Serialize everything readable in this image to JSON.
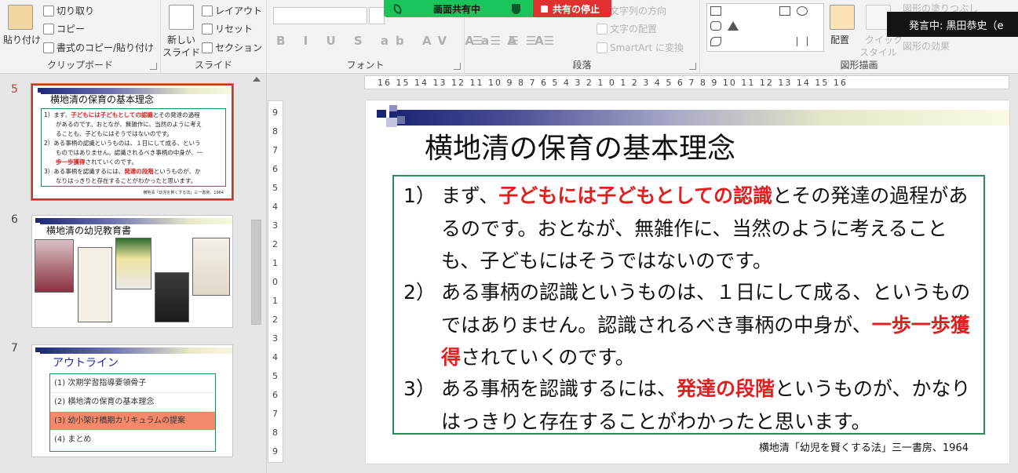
{
  "ribbon": {
    "clipboard": {
      "paste": "貼り付け",
      "cut": "切り取り",
      "copy": "コピー",
      "format_painter": "書式のコピー/貼り付け",
      "label": "クリップボード"
    },
    "slides": {
      "new_slide_line1": "新しい",
      "new_slide_line2": "スライド",
      "layout": "レイアウト",
      "reset": "リセット",
      "section": "セクション",
      "label": "スライド"
    },
    "font": {
      "format_buttons": "B I U S ab AV Aa A A",
      "label": "フォント"
    },
    "paragraph": {
      "text_direction": "文字列の方向",
      "align_text": "文字の配置",
      "smartart": "SmartArt に変換",
      "label": "段落"
    },
    "drawing": {
      "arrange": "配置",
      "quick_styles_line1": "クイック",
      "quick_styles_line2": "スタイル",
      "shape_fill": "図形の塗りつぶし",
      "shape_effects": "図形の効果",
      "label": "図形描画"
    }
  },
  "share_bar": {
    "status": "画面共有中",
    "stop": "共有の停止"
  },
  "speaker_tooltip": "発言中: 黒田恭史（e",
  "thumbnails": [
    {
      "number": "5",
      "title": "横地清の保育の基本理念",
      "lines": [
        {
          "pre": "1）まず、",
          "hl": "子どもには子どもとしての認識",
          "post": "とその発達の過程"
        },
        {
          "pre": "　　があるのです。おとなが、無雑作に、当然のように考え",
          "hl": "",
          "post": ""
        },
        {
          "pre": "　　ることも、子どもにはそうではないのです。",
          "hl": "",
          "post": ""
        },
        {
          "pre": "2）ある事柄の認識というものは、１日にして成る、という",
          "hl": "",
          "post": ""
        },
        {
          "pre": "　　ものではありません。認識されるべき事柄の中身が、一",
          "hl": "",
          "post": ""
        },
        {
          "pre": "　　",
          "hl": "歩一歩獲得",
          "post": "されていくのです。"
        },
        {
          "pre": "3）ある事柄を認識するには、",
          "hl": "発達の段階",
          "post": "というものが、か"
        },
        {
          "pre": "　　なりはっきりと存在することがわかったと思います。",
          "hl": "",
          "post": ""
        }
      ],
      "source": "横地清「幼児を賢くする法」三一書房、1964"
    },
    {
      "number": "6",
      "title": "横地清の幼児教育書"
    },
    {
      "number": "7",
      "title": "アウトライン",
      "items": [
        "(1) 次期学習指導要領骨子",
        "(2) 横地清の保育の基本理念",
        "(3) 幼小架け橋期カリキュラムの提案",
        "(4) まとめ"
      ]
    }
  ],
  "ruler": {
    "horizontal": "16 15 14 13 12 11 10 9 8 7 6 5 4 3 2 1 0 1 2 3 4 5 6 7 8 9 10 11 12 13 14 15 16",
    "vertical": [
      "9",
      "8",
      "7",
      "6",
      "5",
      "4",
      "3",
      "2",
      "1",
      "0",
      "1",
      "2",
      "3",
      "4",
      "5",
      "6",
      "7",
      "8",
      "9"
    ]
  },
  "slide": {
    "title": "横地清の保育の基本理念",
    "points": [
      {
        "num": "1）",
        "pre": "まず、",
        "hl": "子どもには子どもとしての認識",
        "post": "とその発達の過程があるのです。おとなが、無雑作に、当然のように考えることも、子どもにはそうではないのです。"
      },
      {
        "num": "2）",
        "pre": "ある事柄の認識というものは、１日にして成る、というものではありません。認識されるべき事柄の中身が、",
        "hl": "一歩一歩獲得",
        "post": "されていくのです。"
      },
      {
        "num": "3）",
        "pre": "ある事柄を認識するには、",
        "hl": "発達の段階",
        "post": "というものが、かなりはっきりと存在することがわかったと思います。"
      }
    ],
    "source": "横地清「幼児を賢くする法」三一書房、1964"
  },
  "colors": {
    "highlight_red": "#e02020",
    "box_green": "#2e8b57",
    "share_green": "#19c45b",
    "share_red": "#e03030",
    "outline_highlight": "#f4886a"
  }
}
